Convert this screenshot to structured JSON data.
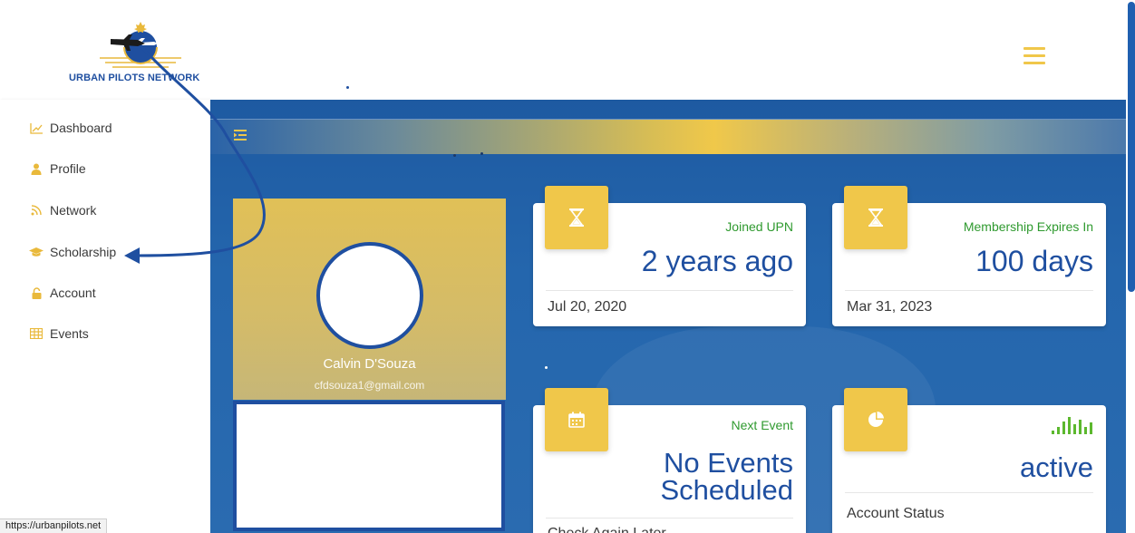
{
  "header": {
    "logo_text": "URBAN PILOTS NETWORK",
    "menu_icon": "hamburger-menu-icon"
  },
  "sidebar": {
    "items": [
      {
        "label": "Dashboard",
        "icon": "chart-line-icon"
      },
      {
        "label": "Profile",
        "icon": "user-icon"
      },
      {
        "label": "Network",
        "icon": "rss-icon"
      },
      {
        "label": "Scholarship",
        "icon": "graduation-cap-icon"
      },
      {
        "label": "Account",
        "icon": "lock-icon"
      },
      {
        "label": "Events",
        "icon": "table-icon"
      }
    ]
  },
  "profile": {
    "name": "Calvin D'Souza",
    "email": "cfdsouza1@gmail.com"
  },
  "cards": {
    "joined": {
      "category": "Joined UPN",
      "value": "2 years ago",
      "footer": "Jul 20, 2020",
      "icon": "hourglass-icon"
    },
    "membership": {
      "category": "Membership Expires In",
      "value": "100 days",
      "footer": "Mar 31, 2023",
      "icon": "hourglass-icon"
    },
    "event": {
      "category": "Next Event",
      "value_line1": "No Events",
      "value_line2": "Scheduled",
      "footer": "Check Again Later",
      "icon": "calendar-icon"
    },
    "status": {
      "value": "active",
      "footer": "Account Status",
      "icon": "pie-chart-icon",
      "signal_icon": "signal-bars-icon"
    }
  },
  "status_bar": {
    "url": "https://urbanpilots.net"
  },
  "colors": {
    "brand_blue": "#1f4fa0",
    "brand_gold": "#f0c74a",
    "accent_green": "#2f9a2f",
    "annotation_arrow": "#1f4fa0"
  }
}
